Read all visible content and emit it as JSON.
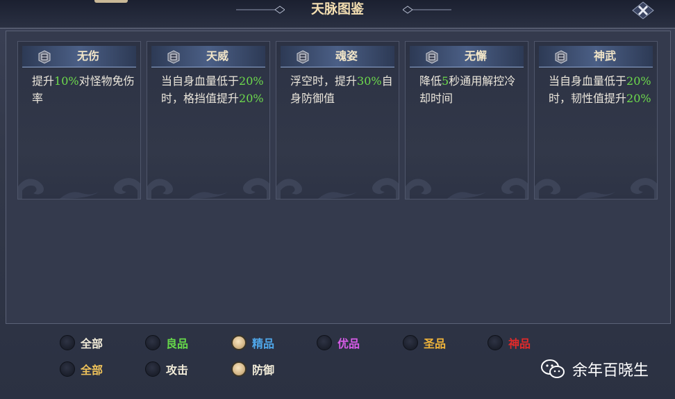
{
  "window": {
    "title": "天脉图鉴"
  },
  "cards": [
    {
      "name": "无伤",
      "desc": [
        {
          "t": "提升",
          "hl": false
        },
        {
          "t": "10%",
          "hl": true
        },
        {
          "t": "对怪物免伤率",
          "hl": false
        }
      ]
    },
    {
      "name": "天威",
      "desc": [
        {
          "t": "当自身血量低于",
          "hl": false
        },
        {
          "t": "20%",
          "hl": true
        },
        {
          "t": "时，格挡值提升",
          "hl": false
        },
        {
          "t": "20%",
          "hl": true
        }
      ]
    },
    {
      "name": "魂姿",
      "desc": [
        {
          "t": "浮空时，提升",
          "hl": false
        },
        {
          "t": "30%",
          "hl": true
        },
        {
          "t": "自身防御值",
          "hl": false
        }
      ]
    },
    {
      "name": "无懈",
      "desc": [
        {
          "t": "降低",
          "hl": false
        },
        {
          "t": "5",
          "hl": true
        },
        {
          "t": "秒通用解控冷却时间",
          "hl": false
        }
      ]
    },
    {
      "name": "神武",
      "desc": [
        {
          "t": "当自身血量低于",
          "hl": false
        },
        {
          "t": "20%",
          "hl": true
        },
        {
          "t": "时，韧性值提升",
          "hl": false
        },
        {
          "t": "20%",
          "hl": true
        }
      ]
    }
  ],
  "quality_filters": [
    {
      "label": "全部",
      "color": "#f2ecd9",
      "selected": false
    },
    {
      "label": "良品",
      "color": "#66d84a",
      "selected": false
    },
    {
      "label": "精品",
      "color": "#4fa7ea",
      "selected": true
    },
    {
      "label": "优品",
      "color": "#d65be7",
      "selected": false
    },
    {
      "label": "圣品",
      "color": "#f0b43a",
      "selected": false
    },
    {
      "label": "神品",
      "color": "#e02a2a",
      "selected": false
    }
  ],
  "type_filters": [
    {
      "label": "全部",
      "color": "#f0c35a",
      "selected": false
    },
    {
      "label": "攻击",
      "color": "#f2ecd9",
      "selected": false
    },
    {
      "label": "防御",
      "color": "#f2ecd9",
      "selected": true
    }
  ],
  "watermark": {
    "text": "余年百晓生",
    "icon": "wechat-icon"
  },
  "colors": {
    "highlight": "#6edb4d",
    "title": "#f3deb1"
  }
}
